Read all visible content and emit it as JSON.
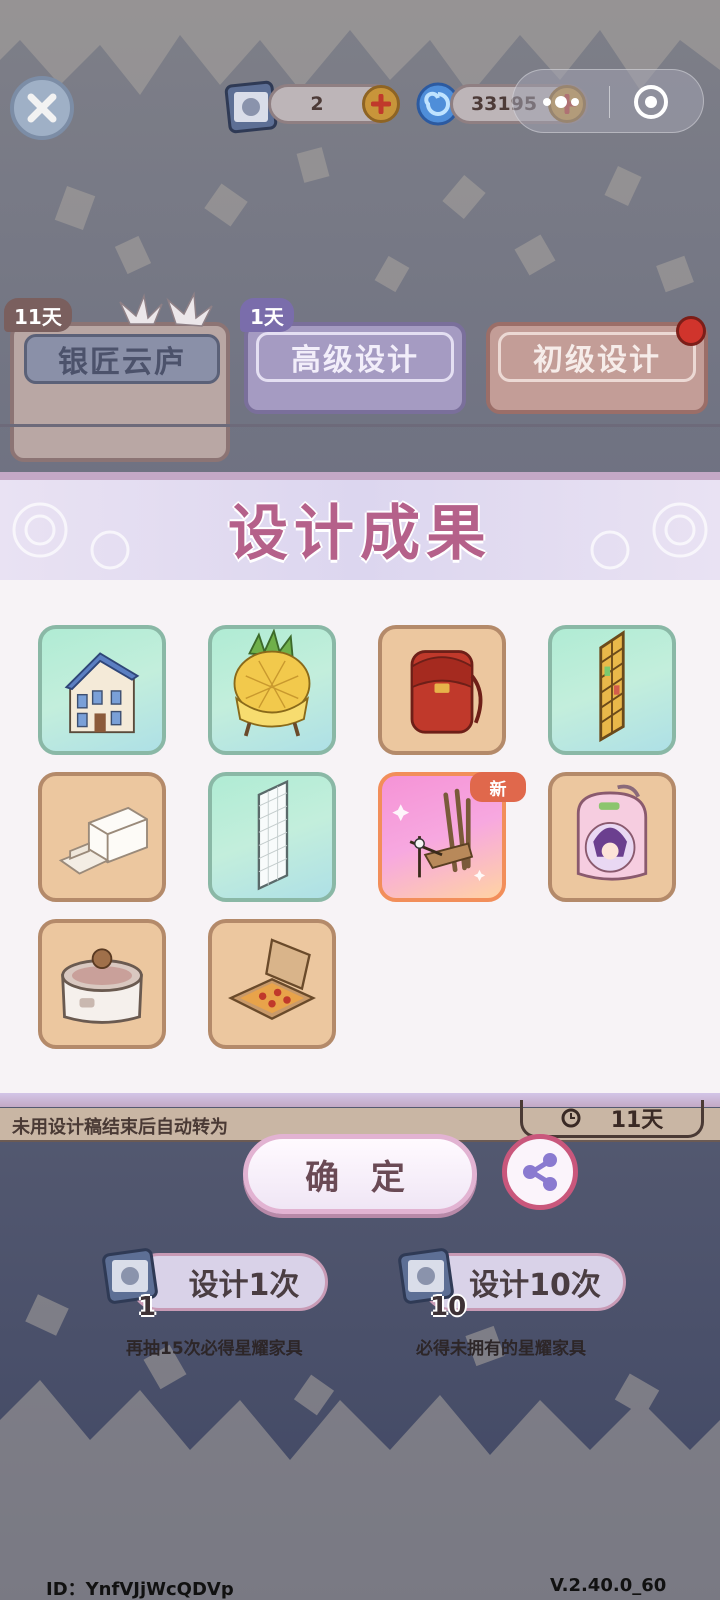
{
  "topbar": {
    "ticket_count": "2",
    "currency_amount": "33195"
  },
  "tabs": [
    {
      "label": "银匠云庐",
      "badge": "11天"
    },
    {
      "label": "高级设计",
      "badge": "1天"
    },
    {
      "label": "初级设计",
      "badge": ""
    }
  ],
  "dialog": {
    "title": "设计成果",
    "items": [
      {
        "name": "townhouse",
        "rarity": "green"
      },
      {
        "name": "pineapple-armchair",
        "rarity": "green"
      },
      {
        "name": "red-school-backpack",
        "rarity": "tan"
      },
      {
        "name": "stained-glass-screen",
        "rarity": "green"
      },
      {
        "name": "white-steps-block",
        "rarity": "tan"
      },
      {
        "name": "glass-panel-screen",
        "rarity": "green"
      },
      {
        "name": "wooden-scaffold",
        "rarity": "pink",
        "tag": "新"
      },
      {
        "name": "anime-pink-backpack",
        "rarity": "tan"
      },
      {
        "name": "hot-pot-cooker",
        "rarity": "tan"
      },
      {
        "name": "pizza-box",
        "rarity": "tan"
      }
    ],
    "confirm_label": "确 定"
  },
  "hint": {
    "text": "未用设计稿结束后自动转为",
    "timer": "11天"
  },
  "draw": {
    "single": {
      "label": "设计1次",
      "cost": "1",
      "note": "再抽15次必得星耀家具"
    },
    "ten": {
      "label": "设计10次",
      "cost": "10",
      "note": "必得未拥有的星耀家具"
    }
  },
  "footer": {
    "id_text": "ID：YnfVJjWcQDVp",
    "version": "V.2.40.0_60"
  },
  "colors": {
    "title": "#b5618a",
    "accent_red": "#c9577c",
    "card_tan": "#ecc79f",
    "card_green": "#b0ecd4",
    "card_pink": "#f593d6"
  }
}
